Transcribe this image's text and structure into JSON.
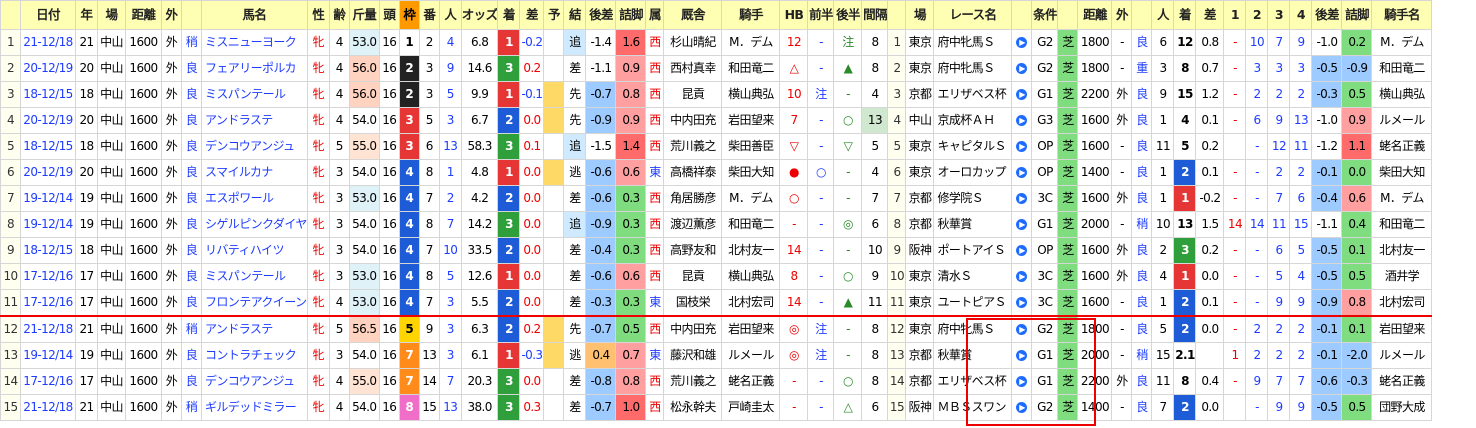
{
  "headers": [
    "",
    "日付",
    "年",
    "場",
    "距離",
    "外",
    "",
    "馬名",
    "性",
    "齢",
    "斤量",
    "頭",
    "枠",
    "番",
    "人",
    "オッズ",
    "着",
    "差",
    "予",
    "結",
    "後差",
    "詰脚",
    "属",
    "厩舎",
    "騎手",
    "HB",
    "前半",
    "後半",
    "間隔",
    "",
    "場",
    "レース名",
    "",
    "条件",
    "",
    "距離",
    "外",
    "",
    "人",
    "着",
    "差",
    "1",
    "2",
    "3",
    "4",
    "後差",
    "詰脚",
    "騎手名"
  ],
  "colors": {
    "waku": {
      "1": "#ffffff",
      "2": "#222222",
      "3": "#e53535",
      "4": "#1e5bd6",
      "5": "#ffd400",
      "6": "#2e9f3a",
      "7": "#ff8c1a",
      "8": "#f06ec8"
    },
    "rank1": "#e53535",
    "rank2": "#1e5bd6",
    "rank3": "#2e9f3a"
  },
  "rows": [
    {
      "no": "1",
      "date": "21-12/18",
      "yr": "21",
      "place": "中山",
      "dist": "1600",
      "side": "外",
      "track": "稍",
      "name": "ミスニューヨーク",
      "sex": "牝",
      "age": "4",
      "kin": "53.0",
      "heads": "16",
      "waku": "1",
      "ban": "2",
      "nin": "4",
      "odds": "6.8",
      "rank": "1",
      "diff": "-0.2",
      "yo": "",
      "kek": "追",
      "kosa": "-1.4",
      "tume": "1.6",
      "zok": "西",
      "stable": "杉山晴紀",
      "jockey": "M．デム",
      "hb": "12",
      "mae": "-",
      "ato": "注",
      "kan": "8",
      "p_no": "1",
      "p_place": "東京",
      "p_race": "府中牝馬Ｓ",
      "p_cls": "G2",
      "p_dist": "1800",
      "p_side": "-",
      "p_track": "良",
      "p_nin": "6",
      "p_rank": "12",
      "p_diff": "0.8",
      "c1": "-",
      "c2": "10",
      "c3": "7",
      "c4": "9",
      "p_kosa": "-1.0",
      "p_tume": "0.2",
      "p_jockey": "M．デム"
    },
    {
      "no": "2",
      "date": "20-12/19",
      "yr": "20",
      "place": "中山",
      "dist": "1600",
      "side": "外",
      "track": "良",
      "name": "フェアリーポルカ",
      "sex": "牝",
      "age": "4",
      "kin": "56.0",
      "heads": "16",
      "waku": "2",
      "ban": "3",
      "nin": "9",
      "odds": "14.6",
      "rank": "3",
      "diff": "0.2",
      "yo": "",
      "kek": "差",
      "kosa": "-1.1",
      "tume": "0.9",
      "zok": "西",
      "stable": "西村真幸",
      "jockey": "和田竜二",
      "hb": "△",
      "mae": "-",
      "ato": "▲",
      "kan": "8",
      "p_no": "2",
      "p_place": "東京",
      "p_race": "府中牝馬Ｓ",
      "p_cls": "G2",
      "p_dist": "1800",
      "p_side": "-",
      "p_track": "重",
      "p_nin": "3",
      "p_rank": "8",
      "p_diff": "0.7",
      "c1": "-",
      "c2": "3",
      "c3": "3",
      "c4": "3",
      "p_kosa": "-0.5",
      "p_tume": "-0.9",
      "p_jockey": "和田竜二"
    },
    {
      "no": "3",
      "date": "18-12/15",
      "yr": "18",
      "place": "中山",
      "dist": "1600",
      "side": "外",
      "track": "良",
      "name": "ミスパンテール",
      "sex": "牝",
      "age": "4",
      "kin": "56.0",
      "heads": "16",
      "waku": "2",
      "ban": "3",
      "nin": "5",
      "odds": "9.9",
      "rank": "1",
      "diff": "-0.1",
      "yo": "",
      "kek": "先",
      "kosa": "-0.7",
      "tume": "0.8",
      "zok": "西",
      "stable": "昆貢",
      "jockey": "横山典弘",
      "hb": "10",
      "mae": "注",
      "ato": "-",
      "kan": "4",
      "p_no": "3",
      "p_place": "京都",
      "p_race": "エリザベス杯",
      "p_cls": "G1",
      "p_dist": "2200",
      "p_side": "外",
      "p_track": "良",
      "p_nin": "9",
      "p_rank": "15",
      "p_diff": "1.2",
      "c1": "-",
      "c2": "2",
      "c3": "2",
      "c4": "2",
      "p_kosa": "-0.3",
      "p_tume": "0.5",
      "p_jockey": "横山典弘"
    },
    {
      "no": "4",
      "date": "20-12/19",
      "yr": "20",
      "place": "中山",
      "dist": "1600",
      "side": "外",
      "track": "良",
      "name": "アンドラステ",
      "sex": "牝",
      "age": "4",
      "kin": "54.0",
      "heads": "16",
      "waku": "3",
      "ban": "5",
      "nin": "3",
      "odds": "6.7",
      "rank": "2",
      "diff": "0.0",
      "yo": "",
      "kek": "先",
      "kosa": "-0.9",
      "tume": "0.9",
      "zok": "西",
      "stable": "中内田充",
      "jockey": "岩田望来",
      "hb": "7",
      "mae": "-",
      "ato": "○",
      "kan": "13",
      "p_no": "4",
      "p_place": "中山",
      "p_race": "京成杯ＡＨ",
      "p_cls": "G3",
      "p_dist": "1600",
      "p_side": "外",
      "p_track": "良",
      "p_nin": "1",
      "p_rank": "4",
      "p_diff": "0.1",
      "c1": "-",
      "c2": "6",
      "c3": "9",
      "c4": "13",
      "p_kosa": "-1.0",
      "p_tume": "0.9",
      "p_jockey": "ルメール"
    },
    {
      "no": "5",
      "date": "18-12/15",
      "yr": "18",
      "place": "中山",
      "dist": "1600",
      "side": "外",
      "track": "良",
      "name": "デンコウアンジュ",
      "sex": "牝",
      "age": "5",
      "kin": "55.0",
      "heads": "16",
      "waku": "3",
      "ban": "6",
      "nin": "13",
      "odds": "58.3",
      "rank": "3",
      "diff": "0.1",
      "yo": "",
      "kek": "追",
      "kosa": "-1.5",
      "tume": "1.4",
      "zok": "西",
      "stable": "荒川義之",
      "jockey": "柴田善臣",
      "hb": "▽",
      "mae": "-",
      "ato": "▽",
      "kan": "5",
      "p_no": "5",
      "p_place": "東京",
      "p_race": "キャピタルＳ",
      "p_cls": "OP",
      "p_dist": "1600",
      "p_side": "-",
      "p_track": "良",
      "p_nin": "11",
      "p_rank": "5",
      "p_diff": "0.2",
      "c1": "",
      "c2": "-",
      "c3": "12",
      "c4": "11",
      "p_kosa": "-1.2",
      "p_tume": "1.1",
      "p_jockey": "蛯名正義"
    },
    {
      "no": "6",
      "date": "20-12/19",
      "yr": "20",
      "place": "中山",
      "dist": "1600",
      "side": "外",
      "track": "良",
      "name": "スマイルカナ",
      "sex": "牝",
      "age": "3",
      "kin": "54.0",
      "heads": "16",
      "waku": "4",
      "ban": "8",
      "nin": "1",
      "odds": "4.8",
      "rank": "1",
      "diff": "0.0",
      "yo": "",
      "kek": "逃",
      "kosa": "-0.6",
      "tume": "0.6",
      "zok": "東",
      "stable": "高橋祥泰",
      "jockey": "柴田大知",
      "hb": "●",
      "mae": "○",
      "ato": "-",
      "kan": "4",
      "p_no": "6",
      "p_place": "東京",
      "p_race": "オーロカップ",
      "p_cls": "OP",
      "p_dist": "1400",
      "p_side": "-",
      "p_track": "良",
      "p_nin": "1",
      "p_rank": "2",
      "p_diff": "0.1",
      "c1": "-",
      "c2": "-",
      "c3": "2",
      "c4": "2",
      "p_kosa": "-0.1",
      "p_tume": "0.0",
      "p_jockey": "柴田大知"
    },
    {
      "no": "7",
      "date": "19-12/14",
      "yr": "19",
      "place": "中山",
      "dist": "1600",
      "side": "外",
      "track": "良",
      "name": "エスポワール",
      "sex": "牝",
      "age": "3",
      "kin": "53.0",
      "heads": "16",
      "waku": "4",
      "ban": "7",
      "nin": "2",
      "odds": "4.2",
      "rank": "2",
      "diff": "0.0",
      "yo": "",
      "kek": "差",
      "kosa": "-0.6",
      "tume": "0.3",
      "zok": "西",
      "stable": "角居勝彦",
      "jockey": "M．デム",
      "hb": "○",
      "mae": "-",
      "ato": "-",
      "kan": "7",
      "p_no": "7",
      "p_place": "京都",
      "p_race": "修学院Ｓ",
      "p_cls": "3C",
      "p_dist": "1600",
      "p_side": "外",
      "p_track": "良",
      "p_nin": "1",
      "p_rank": "1",
      "p_diff": "-0.2",
      "c1": "-",
      "c2": "-",
      "c3": "7",
      "c4": "6",
      "p_kosa": "-0.4",
      "p_tume": "0.6",
      "p_jockey": "M．デム"
    },
    {
      "no": "8",
      "date": "19-12/14",
      "yr": "19",
      "place": "中山",
      "dist": "1600",
      "side": "外",
      "track": "良",
      "name": "シゲルピンクダイヤ",
      "sex": "牝",
      "age": "3",
      "kin": "54.0",
      "heads": "16",
      "waku": "4",
      "ban": "8",
      "nin": "7",
      "odds": "14.2",
      "rank": "3",
      "diff": "0.0",
      "yo": "",
      "kek": "追",
      "kosa": "-0.9",
      "tume": "0.3",
      "zok": "西",
      "stable": "渡辺薫彦",
      "jockey": "和田竜二",
      "hb": "-",
      "mae": "-",
      "ato": "◎",
      "kan": "6",
      "p_no": "8",
      "p_place": "京都",
      "p_race": "秋華賞",
      "p_cls": "G1",
      "p_dist": "2000",
      "p_side": "-",
      "p_track": "稍",
      "p_nin": "10",
      "p_rank": "13",
      "p_diff": "1.5",
      "c1": "14",
      "c2": "14",
      "c3": "11",
      "c4": "15",
      "p_kosa": "-1.1",
      "p_tume": "0.4",
      "p_jockey": "和田竜二"
    },
    {
      "no": "9",
      "date": "18-12/15",
      "yr": "18",
      "place": "中山",
      "dist": "1600",
      "side": "外",
      "track": "良",
      "name": "リバティハイツ",
      "sex": "牝",
      "age": "3",
      "kin": "54.0",
      "heads": "16",
      "waku": "4",
      "ban": "7",
      "nin": "10",
      "odds": "33.5",
      "rank": "2",
      "diff": "0.0",
      "yo": "",
      "kek": "差",
      "kosa": "-0.4",
      "tume": "0.3",
      "zok": "西",
      "stable": "高野友和",
      "jockey": "北村友一",
      "hb": "14",
      "mae": "-",
      "ato": "-",
      "kan": "10",
      "p_no": "9",
      "p_place": "阪神",
      "p_race": "ポートアイＳ",
      "p_cls": "OP",
      "p_dist": "1600",
      "p_side": "外",
      "p_track": "良",
      "p_nin": "2",
      "p_rank": "3",
      "p_diff": "0.2",
      "c1": "-",
      "c2": "-",
      "c3": "6",
      "c4": "5",
      "p_kosa": "-0.5",
      "p_tume": "0.1",
      "p_jockey": "北村友一"
    },
    {
      "no": "10",
      "date": "17-12/16",
      "yr": "17",
      "place": "中山",
      "dist": "1600",
      "side": "外",
      "track": "良",
      "name": "ミスパンテール",
      "sex": "牝",
      "age": "3",
      "kin": "53.0",
      "heads": "16",
      "waku": "4",
      "ban": "8",
      "nin": "5",
      "odds": "12.6",
      "rank": "1",
      "diff": "0.0",
      "yo": "",
      "kek": "差",
      "kosa": "-0.6",
      "tume": "0.6",
      "zok": "西",
      "stable": "昆貢",
      "jockey": "横山典弘",
      "hb": "8",
      "mae": "-",
      "ato": "○",
      "kan": "9",
      "p_no": "10",
      "p_place": "東京",
      "p_race": "清水Ｓ",
      "p_cls": "3C",
      "p_dist": "1600",
      "p_side": "外",
      "p_track": "良",
      "p_nin": "4",
      "p_rank": "1",
      "p_diff": "0.0",
      "c1": "-",
      "c2": "-",
      "c3": "5",
      "c4": "4",
      "p_kosa": "-0.5",
      "p_tume": "0.5",
      "p_jockey": "酒井学"
    },
    {
      "no": "11",
      "date": "17-12/16",
      "yr": "17",
      "place": "中山",
      "dist": "1600",
      "side": "外",
      "track": "良",
      "name": "フロンテアクイーン",
      "sex": "牝",
      "age": "4",
      "kin": "53.0",
      "heads": "16",
      "waku": "4",
      "ban": "7",
      "nin": "3",
      "odds": "5.5",
      "rank": "2",
      "diff": "0.0",
      "yo": "",
      "kek": "差",
      "kosa": "-0.3",
      "tume": "0.3",
      "zok": "東",
      "stable": "国枝栄",
      "jockey": "北村宏司",
      "hb": "14",
      "mae": "-",
      "ato": "▲",
      "kan": "11",
      "p_no": "11",
      "p_place": "東京",
      "p_race": "ユートピアＳ",
      "p_cls": "3C",
      "p_dist": "1600",
      "p_side": "-",
      "p_track": "良",
      "p_nin": "1",
      "p_rank": "2",
      "p_diff": "0.1",
      "c1": "-",
      "c2": "-",
      "c3": "9",
      "c4": "9",
      "p_kosa": "-0.9",
      "p_tume": "0.8",
      "p_jockey": "北村宏司"
    },
    {
      "no": "12",
      "date": "21-12/18",
      "yr": "21",
      "place": "中山",
      "dist": "1600",
      "side": "外",
      "track": "稍",
      "name": "アンドラステ",
      "sex": "牝",
      "age": "5",
      "kin": "56.5",
      "heads": "16",
      "waku": "5",
      "ban": "9",
      "nin": "3",
      "odds": "6.3",
      "rank": "2",
      "diff": "0.2",
      "yo": "",
      "kek": "先",
      "kosa": "-0.7",
      "tume": "0.5",
      "zok": "西",
      "stable": "中内田充",
      "jockey": "岩田望来",
      "hb": "◎",
      "mae": "注",
      "ato": "-",
      "kan": "8",
      "p_no": "12",
      "p_place": "東京",
      "p_race": "府中牝馬Ｓ",
      "p_cls": "G2",
      "p_dist": "1800",
      "p_side": "-",
      "p_track": "良",
      "p_nin": "5",
      "p_rank": "2",
      "p_diff": "0.0",
      "c1": "-",
      "c2": "2",
      "c3": "2",
      "c4": "2",
      "p_kosa": "-0.1",
      "p_tume": "0.1",
      "p_jockey": "岩田望来"
    },
    {
      "no": "13",
      "date": "19-12/14",
      "yr": "19",
      "place": "中山",
      "dist": "1600",
      "side": "外",
      "track": "良",
      "name": "コントラチェック",
      "sex": "牝",
      "age": "3",
      "kin": "54.0",
      "heads": "16",
      "waku": "7",
      "ban": "13",
      "nin": "3",
      "odds": "6.1",
      "rank": "1",
      "diff": "-0.3",
      "yo": "",
      "kek": "逃",
      "kosa": "0.4",
      "tume": "0.7",
      "zok": "東",
      "stable": "藤沢和雄",
      "jockey": "ルメール",
      "hb": "◎",
      "mae": "注",
      "ato": "-",
      "kan": "8",
      "p_no": "13",
      "p_place": "京都",
      "p_race": "秋華賞",
      "p_cls": "G1",
      "p_dist": "2000",
      "p_side": "-",
      "p_track": "稍",
      "p_nin": "15",
      "p_rank": "2.1",
      "p_diff": "",
      "c1": "1",
      "c2": "2",
      "c3": "2",
      "c4": "2",
      "p_kosa": "-0.1",
      "p_tume": "-2.0",
      "p_jockey": "ルメール"
    },
    {
      "no": "14",
      "date": "17-12/16",
      "yr": "17",
      "place": "中山",
      "dist": "1600",
      "side": "外",
      "track": "良",
      "name": "デンコウアンジュ",
      "sex": "牝",
      "age": "4",
      "kin": "55.0",
      "heads": "16",
      "waku": "7",
      "ban": "14",
      "nin": "7",
      "odds": "20.3",
      "rank": "3",
      "diff": "0.0",
      "yo": "",
      "kek": "差",
      "kosa": "-0.8",
      "tume": "0.8",
      "zok": "西",
      "stable": "荒川義之",
      "jockey": "蛯名正義",
      "hb": "-",
      "mae": "-",
      "ato": "○",
      "kan": "8",
      "p_no": "14",
      "p_place": "京都",
      "p_race": "エリザベス杯",
      "p_cls": "G1",
      "p_dist": "2200",
      "p_side": "外",
      "p_track": "良",
      "p_nin": "11",
      "p_rank": "8",
      "p_diff": "0.4",
      "c1": "-",
      "c2": "9",
      "c3": "7",
      "c4": "7",
      "p_kosa": "-0.6",
      "p_tume": "-0.3",
      "p_jockey": "蛯名正義"
    },
    {
      "no": "15",
      "date": "21-12/18",
      "yr": "21",
      "place": "中山",
      "dist": "1600",
      "side": "外",
      "track": "稍",
      "name": "ギルデッドミラー",
      "sex": "牝",
      "age": "4",
      "kin": "54.0",
      "heads": "16",
      "waku": "8",
      "ban": "15",
      "nin": "13",
      "odds": "38.0",
      "rank": "3",
      "diff": "0.3",
      "yo": "",
      "kek": "差",
      "kosa": "-0.7",
      "tume": "1.0",
      "zok": "西",
      "stable": "松永幹夫",
      "jockey": "戸崎圭太",
      "hb": "-",
      "mae": "-",
      "ato": "△",
      "kan": "6",
      "p_no": "15",
      "p_place": "阪神",
      "p_race": "ＭＢＳスワン",
      "p_cls": "G2",
      "p_dist": "1400",
      "p_side": "-",
      "p_track": "良",
      "p_nin": "7",
      "p_rank": "2",
      "p_diff": "0.0",
      "c1": "",
      "c2": "-",
      "c3": "9",
      "c4": "9",
      "p_kosa": "-0.5",
      "p_tume": "0.5",
      "p_jockey": "団野大成"
    }
  ]
}
